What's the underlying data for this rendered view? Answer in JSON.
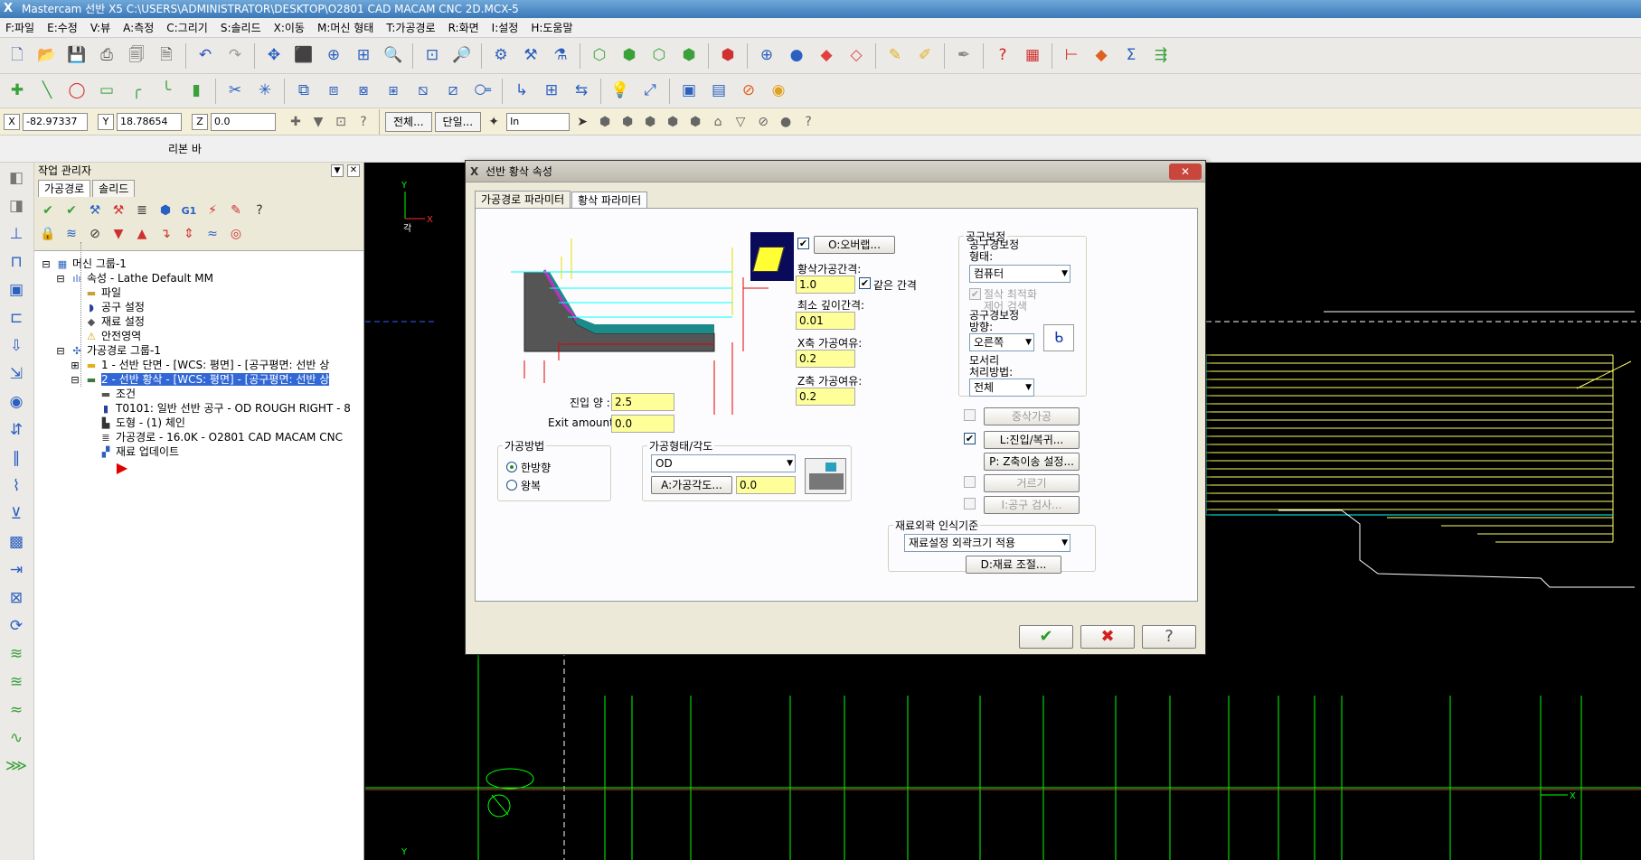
{
  "window": {
    "logo": "X",
    "title": "Mastercam 선반 X5   C:\\USERS\\ADMINISTRATOR\\DESKTOP\\O2801 CAD MACAM CNC 2D.MCX-5"
  },
  "menu": [
    "F:파일",
    "E:수정",
    "V:뷰",
    "A:측정",
    "C:그리기",
    "S:솔리드",
    "X:이동",
    "M:머신 형태",
    "T:가공경로",
    "R:화면",
    "I:설정",
    "H:도움말"
  ],
  "coords": {
    "x_label": "X",
    "x_value": "-82.97337",
    "y_label": "Y",
    "y_value": "18.78654",
    "z_label": "Z",
    "z_value": "0.0",
    "all_label": "전체...",
    "single_label": "단일...",
    "unit_value": "In"
  },
  "ribbon_label": "리본 바",
  "opmgr": {
    "title": "작업 관리자",
    "tabs": [
      "가공경로",
      "솔리드"
    ],
    "tree": [
      {
        "icon": "machine-group-icon",
        "text": "머신 그룹-1"
      },
      {
        "icon": "properties-icon",
        "text": "속성 - Lathe Default MM"
      },
      {
        "icon": "folder-icon",
        "text": "파일"
      },
      {
        "icon": "tool-icon",
        "text": "공구 설정"
      },
      {
        "icon": "stock-icon",
        "text": "재료 설정"
      },
      {
        "icon": "warning-icon",
        "text": "안전영역"
      },
      {
        "icon": "toolpath-group-icon",
        "text": "가공경로 그룹-1"
      },
      {
        "icon": "folder-icon",
        "text": "1 - 선반 단면 - [WCS: 평면] - [공구평면: 선반 상"
      },
      {
        "icon": "folder-open-icon",
        "text": "2 - 선반 황삭 - [WCS: 평면] - [공구평면: 선반 상"
      },
      {
        "icon": "params-icon",
        "text": "조건"
      },
      {
        "icon": "tool-icon",
        "text": "T0101: 일반 선반 공구 - OD ROUGH RIGHT - 8"
      },
      {
        "icon": "geometry-icon",
        "text": "도형 - (1) 체인"
      },
      {
        "icon": "toolpath-icon",
        "text": "가공경로 - 16.0K - O2801 CAD MACAM CNC"
      },
      {
        "icon": "stock-update-icon",
        "text": "재료 업데이트"
      }
    ]
  },
  "dialog": {
    "logo": "X",
    "title": "선반 황삭 속성",
    "close": "✕",
    "tabs": [
      "가공경로 파라미터",
      "황삭 파라미터"
    ],
    "overlap_label": "O:오버랩...",
    "rough_step_label": "황삭가공간격:",
    "rough_step_value": "1.0",
    "equal_step_label": "같은 간격",
    "min_depth_label": "최소 깊이간격:",
    "min_depth_value": "0.01",
    "x_stock_label": "X축 가공여유:",
    "x_stock_value": "0.2",
    "z_stock_label": "Z축 가공여유:",
    "z_stock_value": "0.2",
    "entry_amount_label": "진입 양 :",
    "entry_amount_value": "2.5",
    "exit_amount_label": "Exit amount:",
    "exit_amount_value": "0.0",
    "cut_direction": {
      "title": "가공방법",
      "options": [
        "한방향",
        "왕복"
      ],
      "selected": "한방향"
    },
    "cut_type": {
      "title": "가공형태/각도",
      "value": "OD",
      "angle_label": "A:가공각도...",
      "angle_value": "0.0"
    },
    "comp": {
      "title": "공구보정",
      "type_label": "공구경보정\n형태:",
      "type_value": "컴퓨터",
      "opt_label": "절삭 최적화",
      "opt_label2": "제어 검색",
      "dir_label": "공구경보정\n방향:",
      "dir_value": "오른쪽",
      "corner_label": "모서리\n처리방법:",
      "corner_value": "전체"
    },
    "options": [
      {
        "label": "중삭가공",
        "checked": false,
        "enabled": false
      },
      {
        "label": "L:진입/복귀...",
        "checked": true,
        "enabled": true
      },
      {
        "label": "P: Z축이송 설정...",
        "checked": null,
        "enabled": true
      },
      {
        "label": "거르기",
        "checked": false,
        "enabled": false
      },
      {
        "label": "I:공구 검사...",
        "checked": false,
        "enabled": false
      }
    ],
    "stock_recog": {
      "title": "재료외곽 인식기준",
      "value": "재료설정 외곽크기 적용",
      "adjust_label": "D:재료 조절..."
    },
    "ok": "✔",
    "cancel": "✖",
    "help": "?"
  },
  "gfx": {
    "top_axis_y": "Y",
    "top_axis_x": "X",
    "top_axis_label": "각",
    "bottom_axis_x": "X",
    "bottom_axis_y": "Y"
  },
  "colors": {
    "title_bar": "#3a78b8",
    "dialog_bg": "#ece9d8",
    "input_highlight": "#ffff99",
    "toolpath_yellow": "#ffff66",
    "geometry_green": "#00ff00",
    "toolpath_cyan": "#00ffff"
  }
}
